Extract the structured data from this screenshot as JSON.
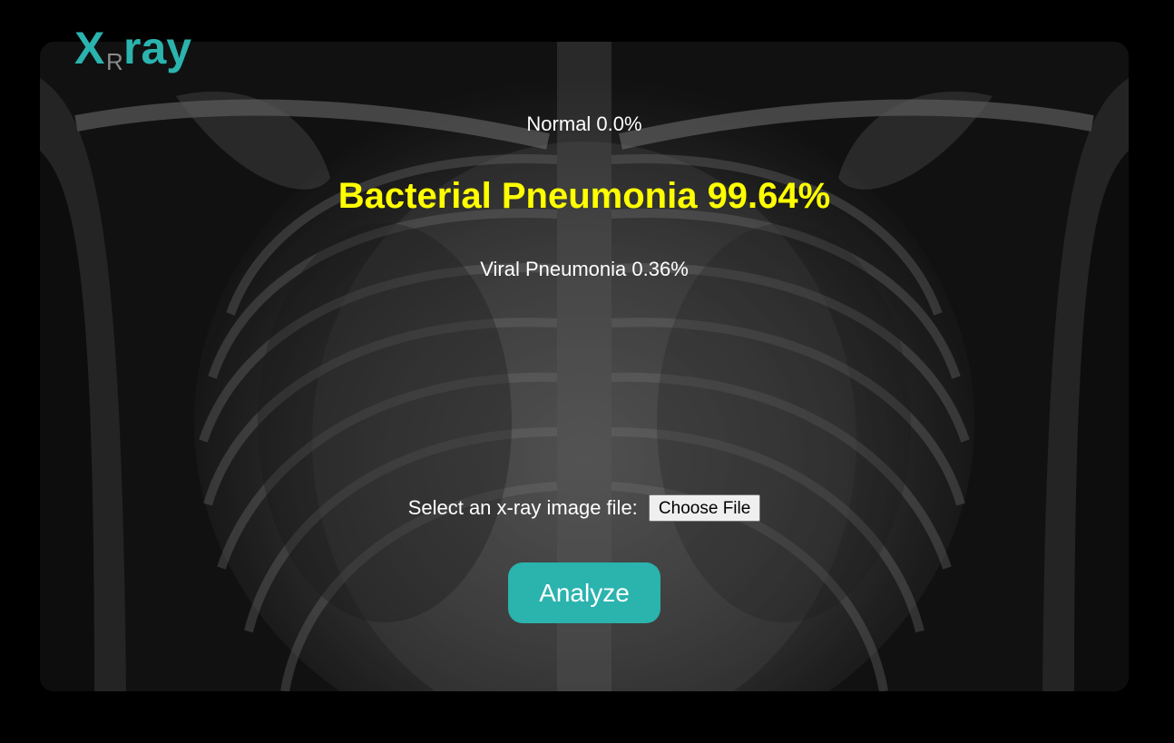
{
  "app": {
    "logo": {
      "x": "X",
      "r": "R",
      "ray": "ray"
    },
    "accent_color": "#2bb3ae"
  },
  "results": {
    "normal": "Normal 0.0%",
    "top": "Bacterial Pneumonia 99.64%",
    "viral": "Viral Pneumonia 0.36%",
    "top_color": "#ffff00"
  },
  "upload": {
    "label": "Select an x-ray image file:",
    "choose_label": "Choose File"
  },
  "actions": {
    "analyze_label": "Analyze"
  },
  "background": {
    "icon": "chest-xray-image"
  }
}
